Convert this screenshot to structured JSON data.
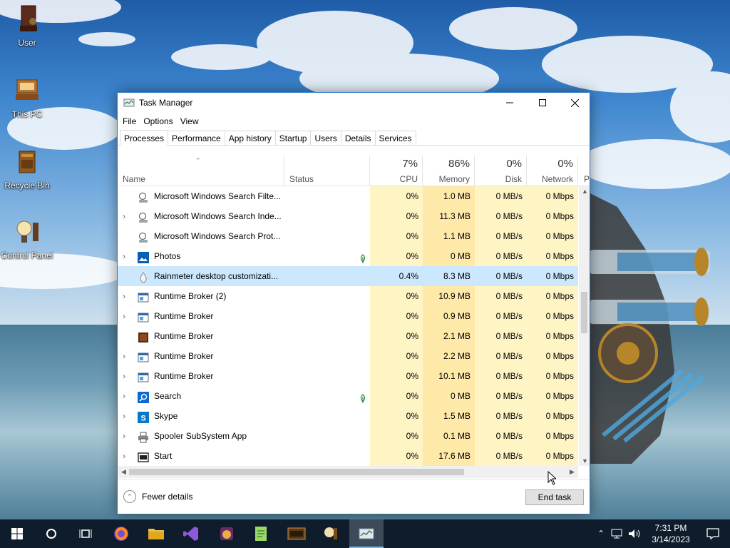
{
  "desktop": {
    "icons": [
      {
        "label": "User"
      },
      {
        "label": "This PC"
      },
      {
        "label": "Recycle Bin"
      },
      {
        "label": "Control Panel"
      }
    ]
  },
  "window": {
    "title": "Task Manager",
    "menu": [
      "File",
      "Options",
      "View"
    ],
    "tabs": [
      "Processes",
      "Performance",
      "App history",
      "Startup",
      "Users",
      "Details",
      "Services"
    ],
    "active_tab": "Processes",
    "columns": {
      "name": "Name",
      "status": "Status",
      "cpu": {
        "pct": "7%",
        "label": "CPU"
      },
      "memory": {
        "pct": "86%",
        "label": "Memory"
      },
      "disk": {
        "pct": "0%",
        "label": "Disk"
      },
      "network": {
        "pct": "0%",
        "label": "Network"
      },
      "power": "P"
    },
    "rows": [
      {
        "name": "Microsoft Windows Search Filte...",
        "expandable": false,
        "icon": "search-service-icon",
        "status_icon": false,
        "cpu": "0%",
        "memory": "1.0 MB",
        "disk": "0 MB/s",
        "network": "0 Mbps"
      },
      {
        "name": "Microsoft Windows Search Inde...",
        "expandable": true,
        "icon": "search-service-icon",
        "status_icon": false,
        "cpu": "0%",
        "memory": "11.3 MB",
        "disk": "0 MB/s",
        "network": "0 Mbps"
      },
      {
        "name": "Microsoft Windows Search Prot...",
        "expandable": false,
        "icon": "search-service-icon",
        "status_icon": false,
        "cpu": "0%",
        "memory": "1.1 MB",
        "disk": "0 MB/s",
        "network": "0 Mbps"
      },
      {
        "name": "Photos",
        "expandable": true,
        "icon": "photos-icon",
        "status_icon": true,
        "cpu": "0%",
        "memory": "0 MB",
        "disk": "0 MB/s",
        "network": "0 Mbps"
      },
      {
        "name": "Rainmeter desktop customizati...",
        "expandable": false,
        "icon": "rainmeter-icon",
        "status_icon": false,
        "cpu": "0.4%",
        "memory": "8.3 MB",
        "disk": "0 MB/s",
        "network": "0 Mbps",
        "selected": true
      },
      {
        "name": "Runtime Broker (2)",
        "expandable": true,
        "icon": "broker-icon",
        "status_icon": false,
        "cpu": "0%",
        "memory": "10.9 MB",
        "disk": "0 MB/s",
        "network": "0 Mbps"
      },
      {
        "name": "Runtime Broker",
        "expandable": true,
        "icon": "broker-icon",
        "status_icon": false,
        "cpu": "0%",
        "memory": "0.9 MB",
        "disk": "0 MB/s",
        "network": "0 Mbps"
      },
      {
        "name": "Runtime Broker",
        "expandable": false,
        "icon": "broker-dark-icon",
        "status_icon": false,
        "cpu": "0%",
        "memory": "2.1 MB",
        "disk": "0 MB/s",
        "network": "0 Mbps"
      },
      {
        "name": "Runtime Broker",
        "expandable": true,
        "icon": "broker-icon",
        "status_icon": false,
        "cpu": "0%",
        "memory": "2.2 MB",
        "disk": "0 MB/s",
        "network": "0 Mbps"
      },
      {
        "name": "Runtime Broker",
        "expandable": true,
        "icon": "broker-icon",
        "status_icon": false,
        "cpu": "0%",
        "memory": "10.1 MB",
        "disk": "0 MB/s",
        "network": "0 Mbps"
      },
      {
        "name": "Search",
        "expandable": true,
        "icon": "search-icon",
        "status_icon": true,
        "cpu": "0%",
        "memory": "0 MB",
        "disk": "0 MB/s",
        "network": "0 Mbps"
      },
      {
        "name": "Skype",
        "expandable": true,
        "icon": "skype-icon",
        "status_icon": false,
        "cpu": "0%",
        "memory": "1.5 MB",
        "disk": "0 MB/s",
        "network": "0 Mbps"
      },
      {
        "name": "Spooler SubSystem App",
        "expandable": true,
        "icon": "printer-icon",
        "status_icon": false,
        "cpu": "0%",
        "memory": "0.1 MB",
        "disk": "0 MB/s",
        "network": "0 Mbps"
      },
      {
        "name": "Start",
        "expandable": true,
        "icon": "start-icon",
        "status_icon": false,
        "cpu": "0%",
        "memory": "17.6 MB",
        "disk": "0 MB/s",
        "network": "0 Mbps"
      }
    ],
    "footer": {
      "fewer_details": "Fewer details",
      "end_task": "End task"
    }
  },
  "taskbar": {
    "clock_time": "7:31 PM",
    "clock_date": "3/14/2023"
  }
}
